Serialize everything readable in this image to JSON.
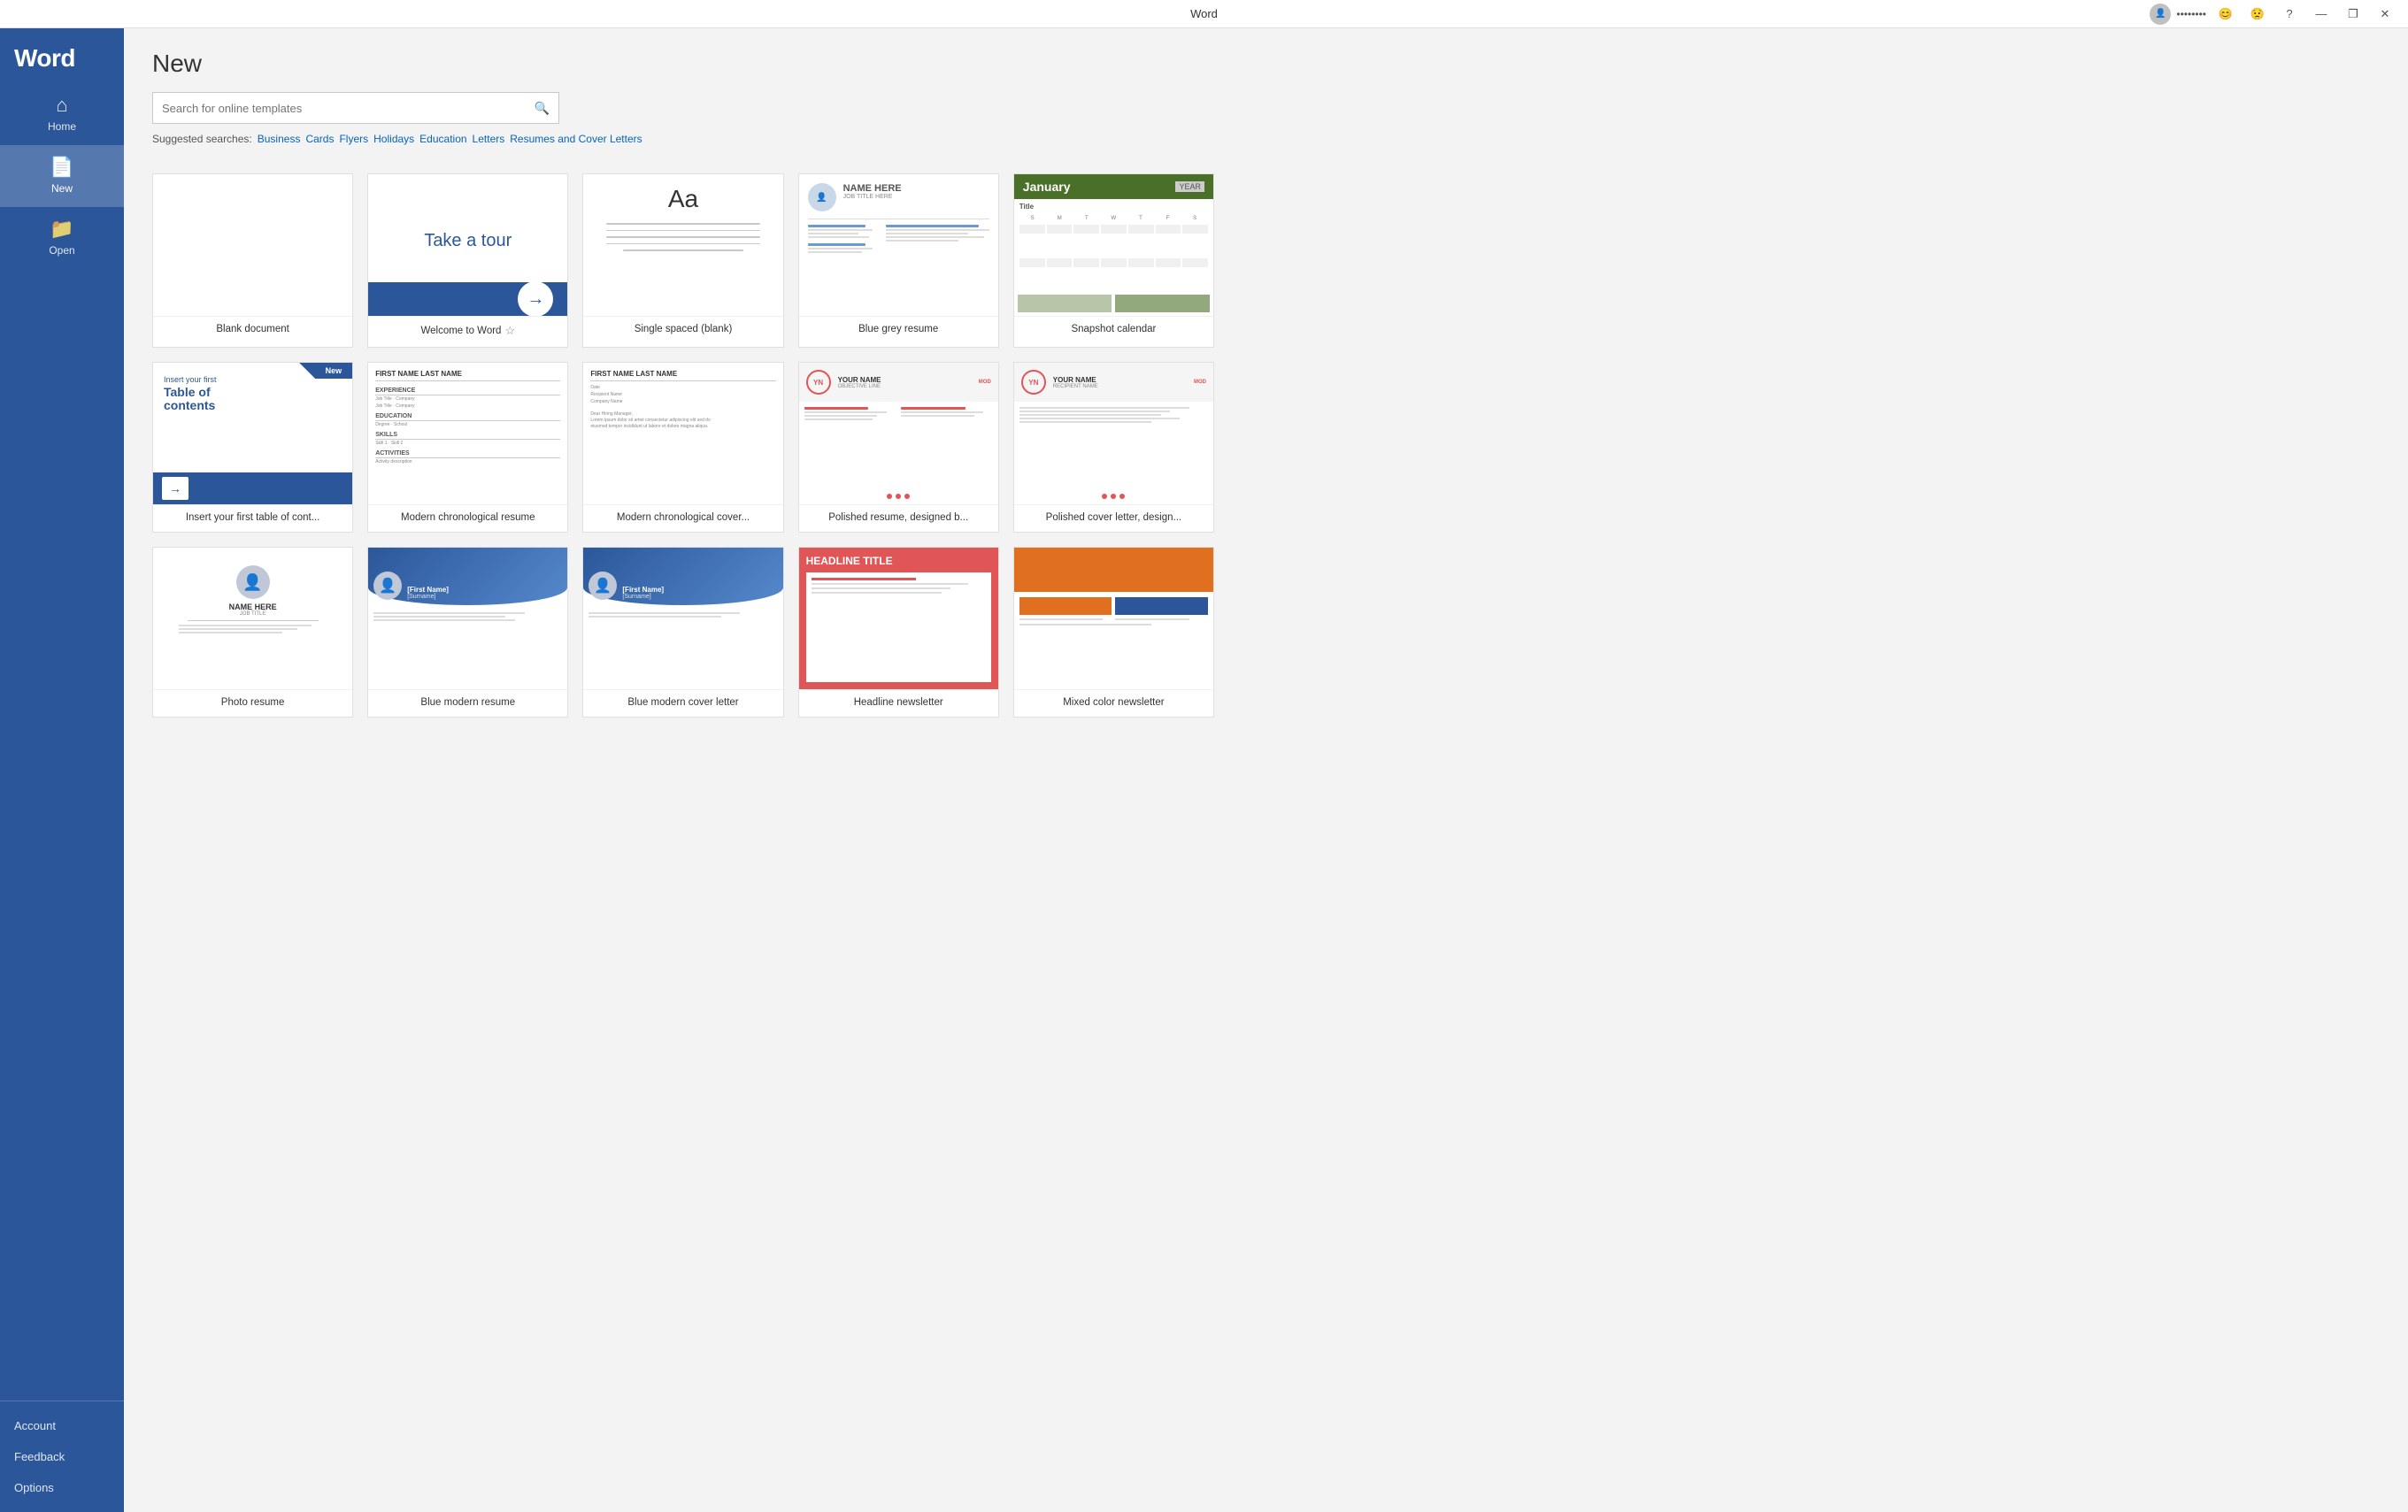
{
  "titlebar": {
    "title": "Word",
    "minimize": "—",
    "maximize": "❐",
    "close": "✕",
    "help": "?",
    "emoji_happy": "😊",
    "emoji_sad": "😟"
  },
  "sidebar": {
    "logo": "Word",
    "nav": [
      {
        "id": "home",
        "label": "Home",
        "icon": "⌂"
      },
      {
        "id": "new",
        "label": "New",
        "icon": "📄"
      },
      {
        "id": "open",
        "label": "Open",
        "icon": "📁"
      }
    ],
    "bottom": [
      {
        "id": "account",
        "label": "Account"
      },
      {
        "id": "feedback",
        "label": "Feedback"
      },
      {
        "id": "options",
        "label": "Options"
      }
    ]
  },
  "main": {
    "title": "New",
    "search": {
      "placeholder": "Search for online templates",
      "value": ""
    },
    "suggested": {
      "label": "Suggested searches:",
      "items": [
        "Business",
        "Cards",
        "Flyers",
        "Holidays",
        "Education",
        "Letters",
        "Resumes and Cover Letters"
      ]
    },
    "templates": {
      "row1": [
        {
          "id": "blank",
          "label": "Blank document",
          "type": "blank"
        },
        {
          "id": "tour",
          "label": "Welcome to Word",
          "type": "tour",
          "has_pin": true
        },
        {
          "id": "single-spaced",
          "label": "Single spaced (blank)",
          "type": "single-spaced"
        },
        {
          "id": "blue-grey-resume",
          "label": "Blue grey resume",
          "type": "blue-grey-resume"
        },
        {
          "id": "snapshot-calendar",
          "label": "Snapshot calendar",
          "type": "calendar"
        }
      ],
      "row2": [
        {
          "id": "toc",
          "label": "Insert your first table of cont...",
          "type": "toc",
          "badge": "New"
        },
        {
          "id": "chron-resume",
          "label": "Modern chronological resume",
          "type": "chron-resume"
        },
        {
          "id": "chron-cover",
          "label": "Modern chronological cover...",
          "type": "chron-cover"
        },
        {
          "id": "polished-resume",
          "label": "Polished resume, designed b...",
          "type": "polished-resume"
        },
        {
          "id": "polished-cover",
          "label": "Polished cover letter, design...",
          "type": "polished-cover"
        }
      ],
      "row3": [
        {
          "id": "photo-resume",
          "label": "Photo resume",
          "type": "photo-resume"
        },
        {
          "id": "blue-resume-1",
          "label": "Blue modern resume",
          "type": "blue-resume-1"
        },
        {
          "id": "blue-resume-2",
          "label": "Blue modern cover letter",
          "type": "blue-resume-2"
        },
        {
          "id": "headline",
          "label": "Headline newsletter",
          "type": "headline"
        },
        {
          "id": "orange-mixed",
          "label": "Mixed color newsletter",
          "type": "orange-mixed"
        }
      ]
    }
  }
}
